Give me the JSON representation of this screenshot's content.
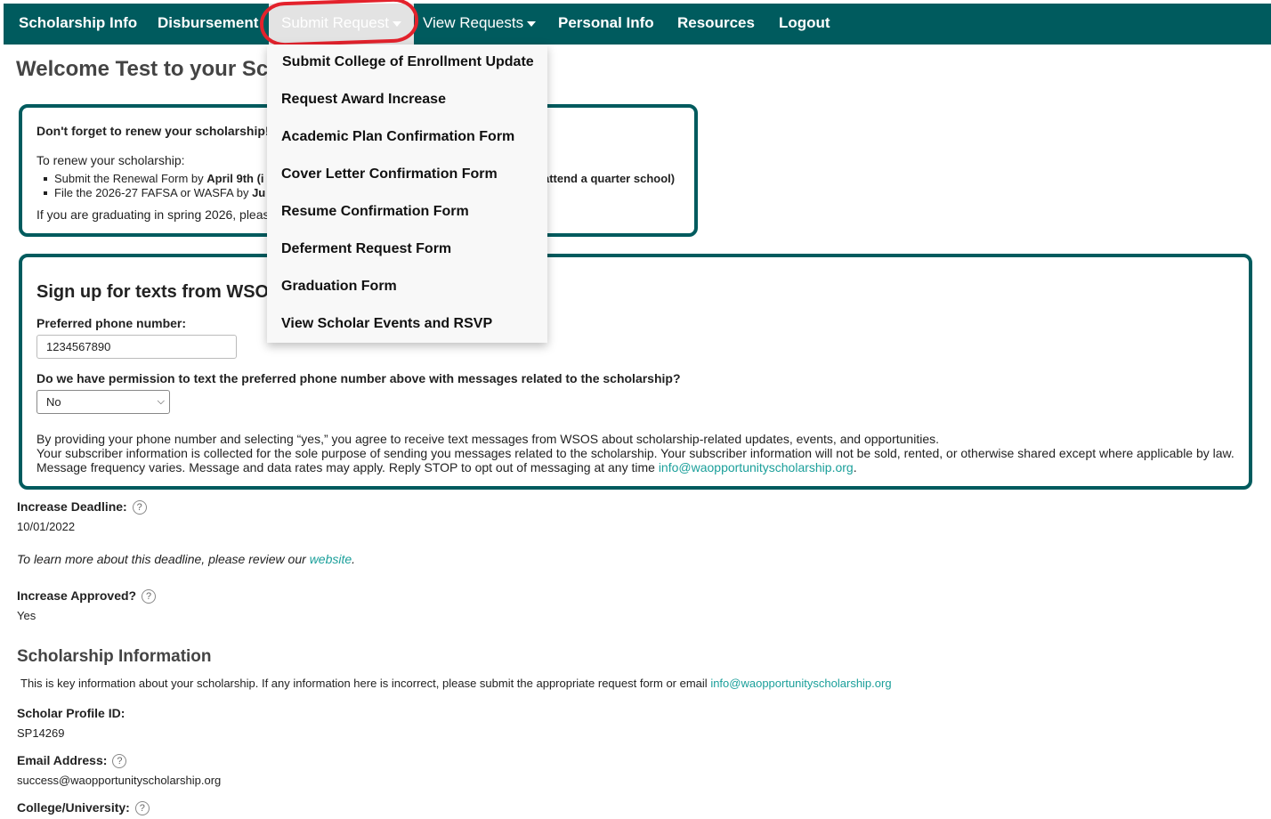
{
  "nav": {
    "items": [
      {
        "label": "Scholarship Info"
      },
      {
        "label": "Disbursement"
      },
      {
        "label": "Submit Request"
      },
      {
        "label": "View Requests"
      },
      {
        "label": "Personal Info"
      },
      {
        "label": "Resources"
      },
      {
        "label": "Logout"
      }
    ]
  },
  "dropdown": {
    "items": [
      "Submit College of Enrollment Update",
      "Request Award Increase",
      "Academic Plan Confirmation Form",
      "Cover Letter Confirmation Form",
      "Resume Confirmation Form",
      "Deferment Request Form",
      "Graduation Form",
      "View Scholar Events and RSVP"
    ]
  },
  "welcome": {
    "title": "Welcome Test to your Sc"
  },
  "renew": {
    "heading": "Don't forget to renew your scholarship!",
    "intro": "To renew your scholarship:",
    "item1_prefix": "Submit the Renewal Form by ",
    "item1_bold": "April 9th (i",
    "item2_prefix": "File the 2026-27 FAFSA or WASFA by ",
    "item2_bold": "Ju",
    "right_text": "attend a quarter school)",
    "footer": "If you are graduating in spring 2026, pleas"
  },
  "sms": {
    "title": "Sign up for texts from WSO",
    "phone_label": "Preferred phone number:",
    "phone_value": "1234567890",
    "permission_label": "Do we have permission to text the preferred phone number above with messages related to the scholarship?",
    "permission_value": "No",
    "disclaimer_line1": "By providing your phone number and selecting “yes,” you agree to receive text messages from WSOS about scholarship-related updates, events, and opportunities.",
    "disclaimer_line2": "Your subscriber information is collected for the sole purpose of sending you messages related to the scholarship. Your subscriber information will not be sold, rented, or otherwise shared except where applicable by law.",
    "disclaimer_line3": "Message frequency varies. Message and data rates may apply. Reply STOP to opt out of messaging at any time ",
    "disclaimer_email": "info@waopportunityscholarship.org",
    "disclaimer_end": "."
  },
  "increase": {
    "deadline_label": "Increase Deadline:",
    "deadline_value": "10/01/2022",
    "note_prefix": "To learn more about this deadline, please review our ",
    "note_link": "website",
    "note_end": ".",
    "approved_label": "Increase Approved?",
    "approved_value": "Yes"
  },
  "scholarship_info": {
    "title": "Scholarship Information",
    "desc_prefix": "This is key information about your scholarship. If any information here is incorrect, please submit the appropriate request form or email ",
    "desc_email": "info@waopportunityscholarship.org",
    "profile_label": "Scholar Profile ID:",
    "profile_value": "SP14269",
    "email_label": "Email Address:",
    "email_value": "success@waopportunityscholarship.org",
    "college_label": "College/University:"
  },
  "help_icon_glyph": "?",
  "colors": {
    "nav_bg": "#005b5e",
    "accent_link": "#1a9f9a",
    "annotation": "#e3222c"
  }
}
